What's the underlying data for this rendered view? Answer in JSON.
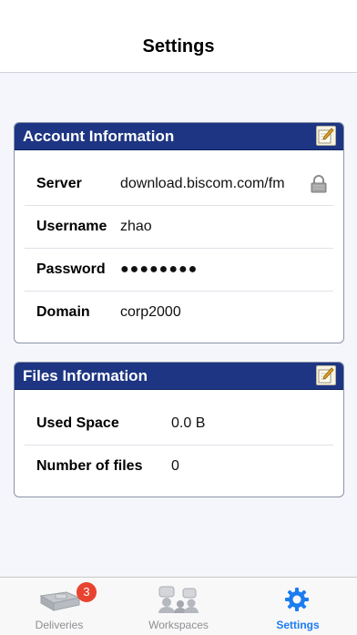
{
  "header": {
    "title": "Settings"
  },
  "account": {
    "title": "Account Information",
    "rows": [
      {
        "label": "Server",
        "value": "download.biscom.com/fm"
      },
      {
        "label": "Username",
        "value": "zhao"
      },
      {
        "label": "Password",
        "value": "●●●●●●●●"
      },
      {
        "label": "Domain",
        "value": "corp2000"
      }
    ]
  },
  "files": {
    "title": "Files Information",
    "rows": [
      {
        "label": "Used Space",
        "value": "0.0 B"
      },
      {
        "label": "Number of files",
        "value": "0"
      }
    ]
  },
  "tabbar": {
    "tabs": [
      {
        "label": "Deliveries",
        "badge": "3"
      },
      {
        "label": "Workspaces"
      },
      {
        "label": "Settings",
        "active": true
      }
    ]
  },
  "colors": {
    "header_bar": "#1d3582",
    "accent_tab": "#1b7cf0",
    "badge": "#e8432f"
  }
}
